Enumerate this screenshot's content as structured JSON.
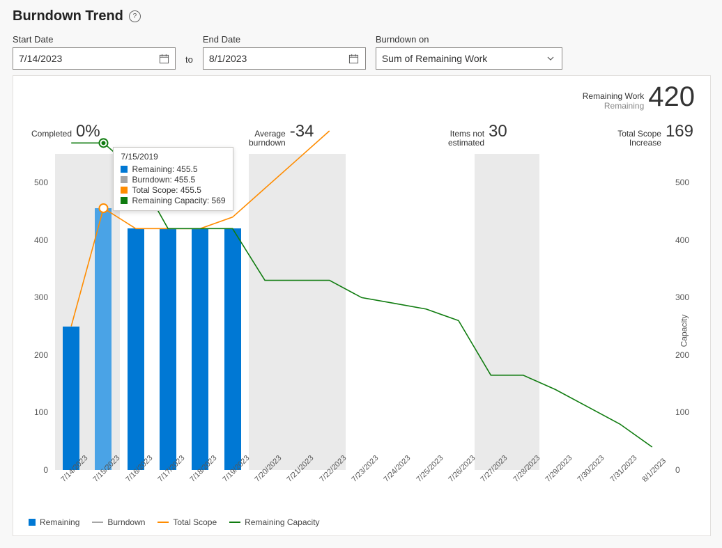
{
  "title": "Burndown Trend",
  "controls": {
    "start_label": "Start Date",
    "start_value": "7/14/2023",
    "to_label": "to",
    "end_label": "End Date",
    "end_value": "8/1/2023",
    "burndown_on_label": "Burndown on",
    "burndown_on_value": "Sum of Remaining Work"
  },
  "remaining_work": {
    "label1": "Remaining Work",
    "label2": "Remaining",
    "value": "420"
  },
  "metrics": {
    "completed_label": "Completed",
    "completed_value": "0%",
    "avg_label_a": "Average",
    "avg_label_b": "burndown",
    "avg_value": "-34",
    "items_label_a": "Items not",
    "items_label_b": "estimated",
    "items_value": "30",
    "scope_label_a": "Total Scope",
    "scope_label_b": "Increase",
    "scope_value": "169"
  },
  "tooltip": {
    "date": "7/15/2019",
    "remaining_label": "Remaining: 455.5",
    "burndown_label": "Burndown: 455.5",
    "scope_label": "Total Scope: 455.5",
    "capacity_label": "Remaining Capacity: 569"
  },
  "legend": {
    "remaining": "Remaining",
    "burndown": "Burndown",
    "scope": "Total Scope",
    "capacity": "Remaining Capacity"
  },
  "y_axis_right_label": "Capacity",
  "chart_data": {
    "type": "bar",
    "title": "Burndown Trend",
    "xlabel": "",
    "ylabel_left": "",
    "ylabel_right": "Capacity",
    "ylim": [
      0,
      550
    ],
    "ylim_right": [
      0,
      550
    ],
    "y_ticks_left": [
      0,
      100,
      200,
      300,
      400,
      500
    ],
    "y_ticks_right": [
      0,
      100,
      200,
      300,
      400,
      500
    ],
    "categories": [
      "7/14/2023",
      "7/15/2023",
      "7/16/2023",
      "7/17/2023",
      "7/18/2023",
      "7/19/2023",
      "7/20/2023",
      "7/21/2023",
      "7/22/2023",
      "7/23/2023",
      "7/24/2023",
      "7/25/2023",
      "7/26/2023",
      "7/27/2023",
      "7/28/2023",
      "7/29/2023",
      "7/30/2023",
      "7/31/2023",
      "8/1/2023"
    ],
    "weekend_bands": [
      [
        "7/14/2023",
        "7/15/2023"
      ],
      [
        "7/20/2023",
        "7/22/2023"
      ],
      [
        "7/27/2023",
        "7/28/2023"
      ]
    ],
    "series": [
      {
        "name": "Remaining",
        "type": "bar",
        "color": "#0078d4",
        "values": [
          250,
          455.5,
          420,
          420,
          420,
          420,
          null,
          null,
          null,
          null,
          null,
          null,
          null,
          null,
          null,
          null,
          null,
          null,
          null
        ]
      },
      {
        "name": "Burndown",
        "type": "line",
        "color": "#a6a6a6",
        "values": [
          250,
          455.5,
          420,
          420,
          420,
          420,
          null,
          null,
          null,
          null,
          null,
          null,
          null,
          null,
          null,
          null,
          null,
          null,
          null
        ]
      },
      {
        "name": "Total Scope",
        "type": "line",
        "color": "#ff8c00",
        "values": [
          250,
          455.5,
          420,
          420,
          420,
          440,
          490,
          540,
          590,
          null,
          null,
          null,
          null,
          null,
          null,
          null,
          null,
          null,
          null
        ]
      },
      {
        "name": "Remaining Capacity",
        "type": "line",
        "color": "#107c10",
        "values": [
          569,
          569,
          520,
          420,
          420,
          420,
          330,
          330,
          330,
          300,
          290,
          280,
          260,
          165,
          165,
          140,
          110,
          80,
          40
        ]
      }
    ]
  }
}
